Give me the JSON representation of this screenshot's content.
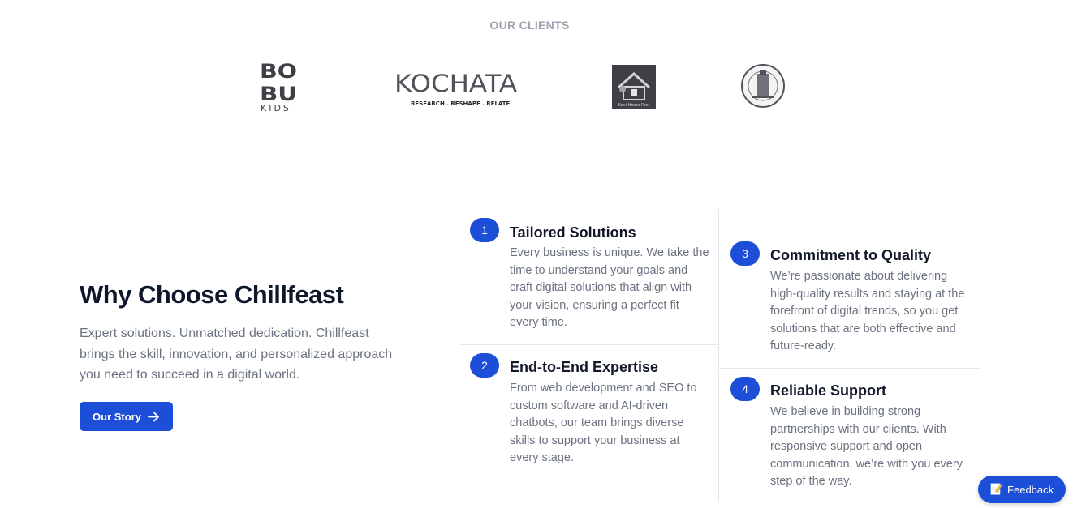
{
  "clients": {
    "title": "OUR CLIENTS",
    "logos": [
      {
        "name": "BOBU KIDS",
        "line1": "BO",
        "line2": "BU",
        "sub": "KIDS"
      },
      {
        "name": "KOCHATA",
        "word": "KOCHATA",
        "tagline": "RESEARCH . RESHAPE . RELATE"
      },
      {
        "name": "Kovi Home Pest",
        "caption": "Kovi Home Pest"
      },
      {
        "name": "Government seal"
      }
    ]
  },
  "why": {
    "title": "Why Choose Chillfeast",
    "description": "Expert solutions. Unmatched dedication. Chillfeast brings the skill, innovation, and personalized approach you need to succeed in a digital world.",
    "button_label": "Our Story"
  },
  "features": [
    {
      "num": "1",
      "title": "Tailored Solutions",
      "description": "Every business is unique. We take the time to understand your goals and craft digital solutions that align with your vision, ensuring a perfect fit every time."
    },
    {
      "num": "2",
      "title": "End-to-End Expertise",
      "description": "From web development and SEO to custom software and AI-driven chatbots, our team brings diverse skills to support your business at every stage."
    },
    {
      "num": "3",
      "title": "Commitment to Quality",
      "description": "We’re passionate about delivering high-quality results and staying at the forefront of digital trends, so you get solutions that are both effective and future-ready."
    },
    {
      "num": "4",
      "title": "Reliable Support",
      "description": "We believe in building strong partnerships with our clients. With responsive support and open communication, we’re with you every step of the way."
    }
  ],
  "feedback": {
    "label": "Feedback",
    "icon": "memo-icon"
  },
  "colors": {
    "accent": "#1d4ed8",
    "muted_text": "#6b7280",
    "heading": "#0f172a"
  }
}
